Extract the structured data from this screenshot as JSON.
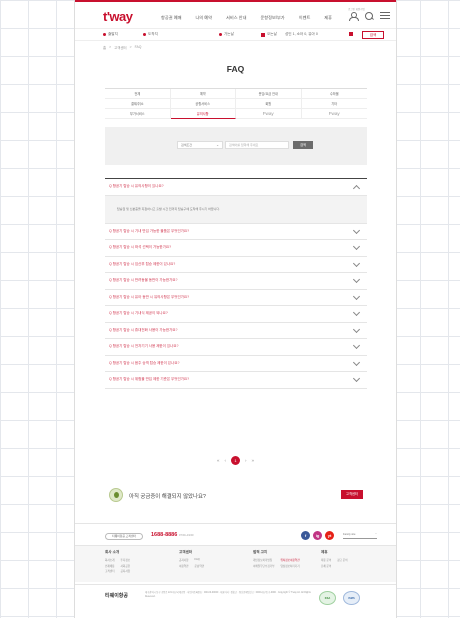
{
  "header": {
    "logo_main": "t'way",
    "menu": [
      "항공권 예매",
      "나의 예약",
      "서비스 안내",
      "운항정보/부가",
      "이벤트",
      "제휴"
    ],
    "util_tiny": "로그인 회원가입"
  },
  "quick": {
    "items": [
      "출발지",
      "도착지",
      "가는날",
      "오는날",
      "성인 1, 소아 0, 유아 0"
    ],
    "submit": "검색"
  },
  "breadcrumb": [
    "홈",
    "고객센터",
    "FAQ"
  ],
  "page_title": "FAQ",
  "categories": [
    {
      "label": "전체",
      "active": false
    },
    {
      "label": "예약",
      "active": false
    },
    {
      "label": "운임/요금 안내",
      "active": false
    },
    {
      "label": "수하물",
      "active": false
    },
    {
      "label": "결제/취소",
      "active": false
    },
    {
      "label": "공항서비스",
      "active": false
    },
    {
      "label": "회원",
      "active": false
    },
    {
      "label": "기타",
      "active": false
    },
    {
      "label": "부가서비스",
      "active": false
    },
    {
      "label": "유의사항",
      "active": true
    },
    {
      "label": "Fway",
      "active": false
    },
    {
      "label": "Fway",
      "active": false
    }
  ],
  "search": {
    "select_value": "검색조건",
    "placeholder": "검색어를 입력해 주세요",
    "button": "검색"
  },
  "faq": [
    {
      "q": "Q 항공기 탑승 시 유의사항이 있나요?",
      "open": true,
      "a": "탑승권 및 신분증을 지참하시고 출발 시간 전까지 탑승구에 도착해 주시기 바랍니다."
    },
    {
      "q": "Q 항공기 탑승 시 기내 반입 가능한 물품은 무엇인가요?",
      "open": false
    },
    {
      "q": "Q 항공기 탑승 시 좌석 선택이 가능한가요?",
      "open": false
    },
    {
      "q": "Q 항공기 탑승 시 임산부 탑승 제한이 있나요?",
      "open": false
    },
    {
      "q": "Q 항공기 탑승 시 반려동물 동반이 가능한가요?",
      "open": false
    },
    {
      "q": "Q 항공기 탑승 시 유아 동반 시 유의사항은 무엇인가요?",
      "open": false
    },
    {
      "q": "Q 항공기 탑승 시 기내식 제공이 되나요?",
      "open": false
    },
    {
      "q": "Q 항공기 탑승 시 휴대전화 사용이 가능한가요?",
      "open": false
    },
    {
      "q": "Q 항공기 탑승 시 전자기기 사용 제한이 있나요?",
      "open": false
    },
    {
      "q": "Q 항공기 탑승 시 음주 승객 탑승 제한이 있나요?",
      "open": false
    },
    {
      "q": "Q 항공기 탑승 시 위험물 반입 제한 기준은 무엇인가요?",
      "open": false
    }
  ],
  "pager": {
    "first": "«",
    "prev": "‹",
    "current": "1",
    "next": "›",
    "last": "»"
  },
  "help": {
    "text": "아직 궁금증이 해결되지 않았나요?",
    "button": "고객센터"
  },
  "footer": {
    "pill": "티웨이항공 고객센터",
    "phone": "1688-8886",
    "hours": "07:00~19:00",
    "social": [
      "f",
      "ig",
      "yt"
    ],
    "family_label": "Family site",
    "cols": [
      {
        "h": "회사 소개",
        "items": [
          "회사소개",
          "투자정보",
          "인재채용",
          "사회공헌",
          "고객센터",
          "공지사항"
        ]
      },
      {
        "h": "고객센터",
        "items": [
          "공지사항",
          "FAQ",
          "이용약관",
          "운송약관"
        ]
      },
      {
        "h": "법적 고지",
        "items": [
          "개인정보처리방침",
          "위치정보이용약관",
          "이메일무단수집거부",
          "영상정보처리기기"
        ],
        "red": 1
      },
      {
        "h": "제휴",
        "items": [
          "제휴 문의",
          "광고 문의",
          "단체 문의"
        ]
      }
    ],
    "corp_name": "티웨이항공",
    "address": "대구광역시 동구 공항로 221 대구국제공항 · 사업자등록번호 : 000-00-00000 · 대표이사 : 정홍근 · 통신판매업신고 : 0000-대구동구-0000 · Copyright © T'way Air. All Rights Reserved.",
    "certs": [
      "KSA",
      "ISMS"
    ]
  },
  "colors": {
    "brand": "#c8102e",
    "bg_grid": "#e4e7ec"
  }
}
